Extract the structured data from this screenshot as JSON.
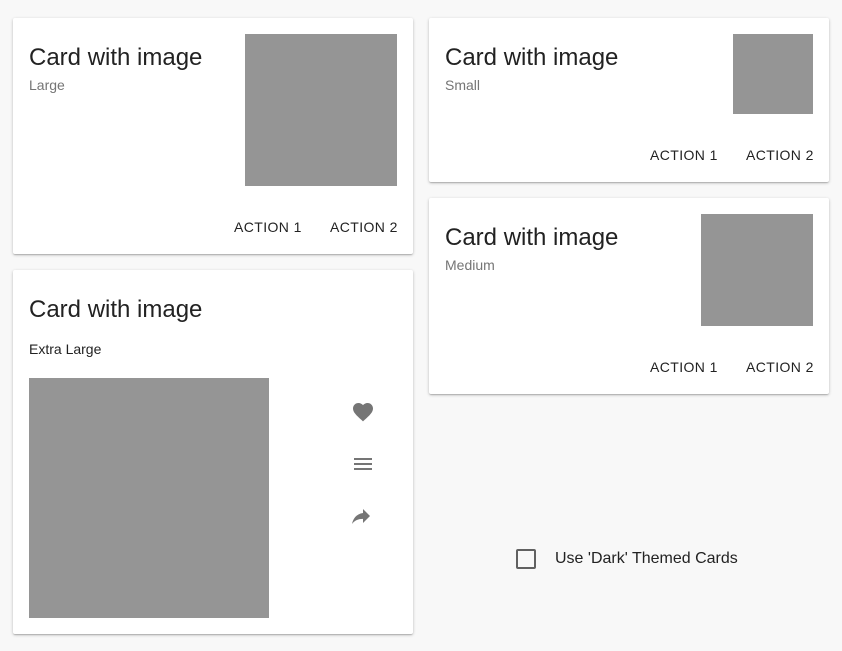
{
  "cards": {
    "large": {
      "title": "Card with image",
      "subtitle": "Large",
      "action1": "ACTION 1",
      "action2": "ACTION 2"
    },
    "small": {
      "title": "Card with image",
      "subtitle": "Small",
      "action1": "ACTION 1",
      "action2": "ACTION 2"
    },
    "medium": {
      "title": "Card with image",
      "subtitle": "Medium",
      "action1": "ACTION 1",
      "action2": "ACTION 2"
    },
    "extra_large": {
      "title": "Card with image",
      "subtitle": "Extra Large",
      "icons": [
        "heart-icon",
        "menu-icon",
        "share-icon"
      ]
    }
  },
  "dark_theme_toggle": {
    "label": "Use 'Dark' Themed Cards",
    "checked": false
  },
  "colors": {
    "page_background": "#f8f8f8",
    "card_background": "#ffffff",
    "media_placeholder": "#959595",
    "icon": "#757575"
  }
}
